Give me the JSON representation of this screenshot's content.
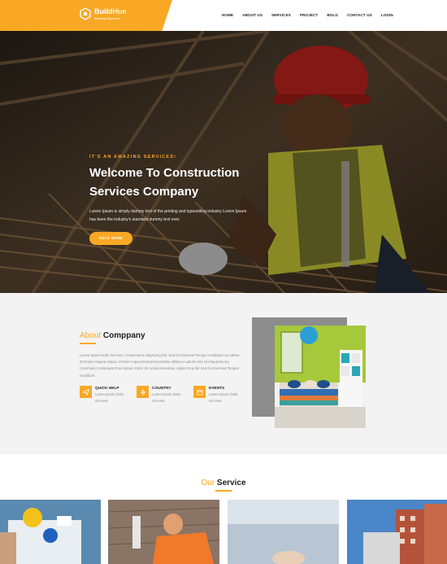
{
  "header": {
    "logo_main_a": "Build",
    "logo_main_b": "Hue",
    "logo_sub": "Building Business",
    "nav": [
      "HOME",
      "ABOUT US",
      "SERVICES",
      "PROJECT",
      "BOLG",
      "CONTACT US",
      "LOGIN"
    ]
  },
  "hero": {
    "tagline": "IT'S AN AMAZING SERVICES!",
    "title": "Welcome To Construction Services Company",
    "text": "Lorem Ipsum is simply dummy text of the printing and typesetting industry Lorem Ipsum has been the industry's standard dummy text ever.",
    "button": "READ MORE"
  },
  "about": {
    "title_accent": "About",
    "title_main": "Comppany",
    "text": "Lorem Ipsum Dolor Sit Amet, Consectetur Adipiscing Elit, Sed Do Eiusmod Tempor Incididunt Ut Labore Et Dolore Magna Aliqua. Ut Enim Aqua Nostrud Exercitatio Ullamco Laboris Nisi Ut Aliquip Ex Ea Commodo Consequat Orem Ipsum Dolor Sit Ametconsectetur Adipis Cing Elit Sed Do Eiusmod Tempor Incididunt",
    "features": [
      {
        "title": "QUICK HELP",
        "desc": "Lorem Ipsum Dolor Sit Amet",
        "icon": "paper-plane-icon"
      },
      {
        "title": "COUNTRY",
        "desc": "Lorem Ipsum Dolor Sit Amet",
        "icon": "bolt-icon"
      },
      {
        "title": "EVENTS",
        "desc": "Lorem Ipsum Dolor Sit Amet",
        "icon": "calendar-icon"
      }
    ]
  },
  "service": {
    "title_accent": "Our",
    "title_main": "Service"
  },
  "colors": {
    "accent": "#f9a825",
    "dark": "#222222"
  }
}
